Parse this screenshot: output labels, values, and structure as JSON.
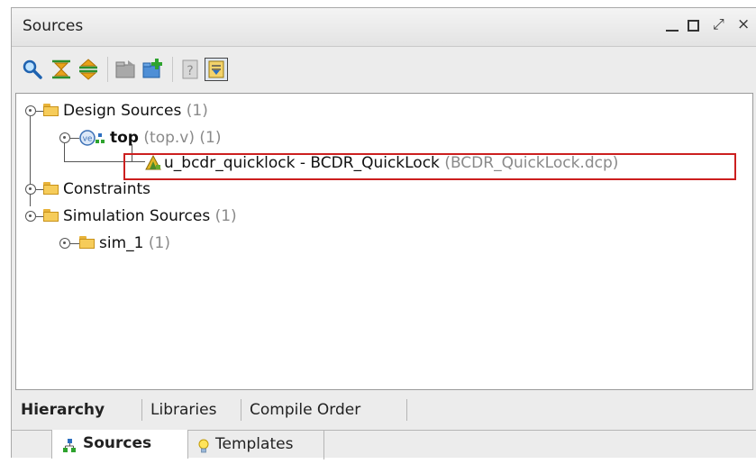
{
  "panel": {
    "title": "Sources"
  },
  "window_controls": {
    "minimize": "minimize",
    "maximize": "maximize",
    "float": "⤢",
    "close": "×"
  },
  "toolbar": {
    "buttons": [
      "search-icon",
      "collapse-all-icon",
      "expand-all-icon",
      "open-folder-icon",
      "add-sources-icon",
      "properties-icon",
      "show-hierarchy-icon"
    ]
  },
  "tree": {
    "design_sources": {
      "label": "Design Sources",
      "count": "(1)"
    },
    "top": {
      "label": "top",
      "file": "(top.v)",
      "count": "(1)"
    },
    "instance": {
      "label": "u_bcdr_quicklock - BCDR_QuickLock",
      "file": "(BCDR_QuickLock.dcp)"
    },
    "constraints": {
      "label": "Constraints"
    },
    "simulation_sources": {
      "label": "Simulation Sources",
      "count": "(1)"
    },
    "sim_1": {
      "label": "sim_1",
      "count": "(1)"
    }
  },
  "view_tabs": [
    "Hierarchy",
    "Libraries",
    "Compile Order"
  ],
  "active_view_tab": "Hierarchy",
  "bottom_tabs": [
    "Sources",
    "Templates"
  ],
  "active_bottom_tab": "Sources",
  "colors": {
    "highlight": "#cc1f1f",
    "folder": "#f6cc5a"
  }
}
